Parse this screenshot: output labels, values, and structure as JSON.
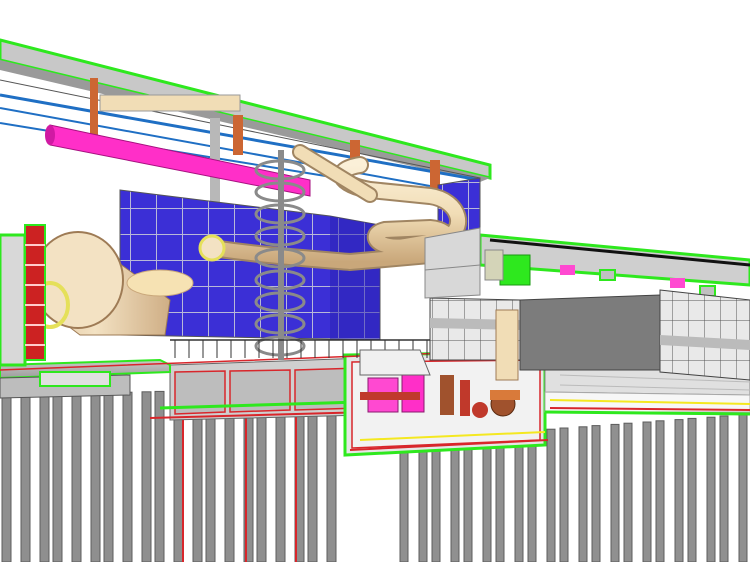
{
  "scene": {
    "colors": {
      "background": "#ffffff",
      "structure": "#d6d6d6",
      "structure_dark": "#a9a9a9",
      "outline_green": "#2ee81e",
      "outline_red": "#d8262b",
      "glass_blue": "#3b2fd6",
      "duct_magenta": "#ff2fc8",
      "slide_tan": "#f1ddb6",
      "pile_grey": "#8f8f8f",
      "beam_blue": "#1f6fc4",
      "yellow_line": "#f4e820",
      "pump_red": "#c0392b",
      "pump_pink": "#ff49d1",
      "pump_brown": "#a0522d"
    },
    "icons": {
      "staircase": "spiral-staircase-icon",
      "slide": "water-slide-icon",
      "duct": "air-duct-icon",
      "funnel": "cone-tank-icon"
    }
  }
}
